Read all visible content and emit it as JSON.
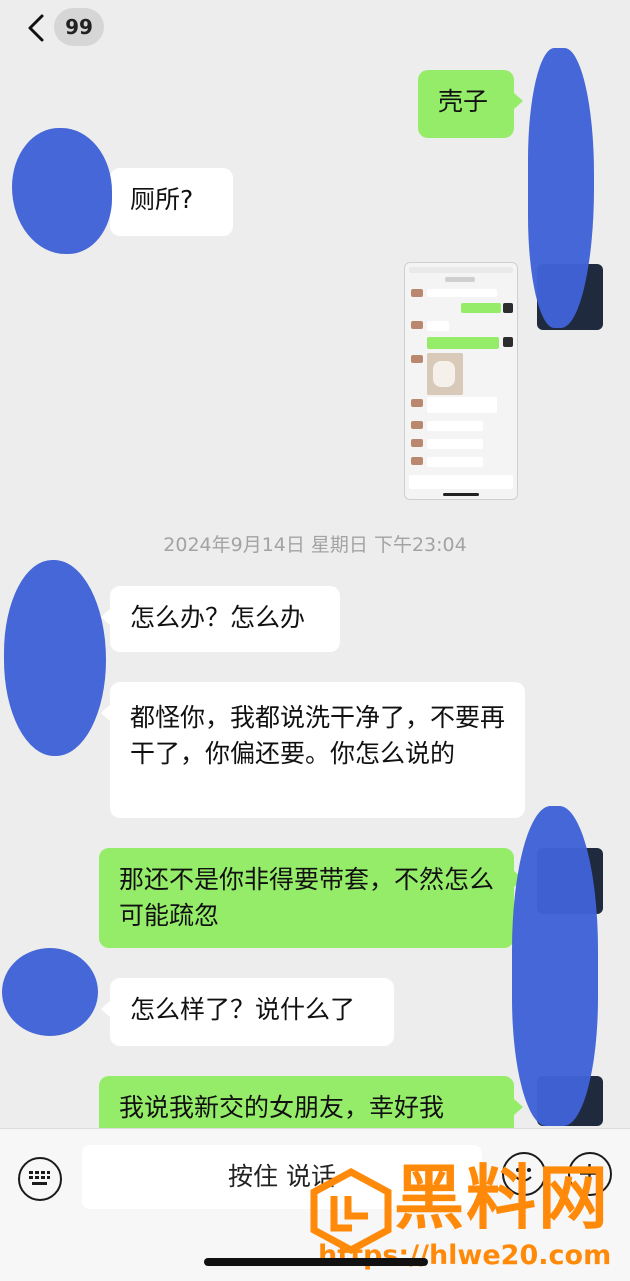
{
  "header": {
    "unread_count": "99"
  },
  "messages": {
    "m1": "壳子",
    "m2": "厕所?",
    "m3": "怎么办？怎么办",
    "m4": "都怪你，我都说洗干净了，不要再干了，你偏还要。你怎么说的",
    "m5": "那还不是你非得要带套，不然怎么可能疏忽",
    "m6": "怎么样了？说什么了",
    "m7": "我说我新交的女朋友，幸好我"
  },
  "timestamp": "2024年9月14日 星期日 下午23:04",
  "input_bar": {
    "hold_to_talk": "按住 说话"
  },
  "watermark": {
    "brand": "黑料网",
    "url": "https://hlwe20.com"
  },
  "colors": {
    "background": "#ededed",
    "incoming_bubble": "#ffffff",
    "outgoing_bubble": "#95ec69",
    "redaction": "#3f62d6",
    "watermark": "#ff8a0a"
  }
}
